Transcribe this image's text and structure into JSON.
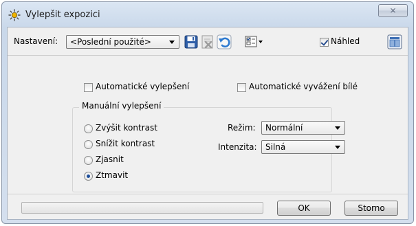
{
  "window": {
    "title": "Vylepšit expozici",
    "close_glyph": "⨯"
  },
  "toolbar": {
    "settings_label": "Nastavení:",
    "settings_value": "<Poslední použité>",
    "save_icon": "floppy-disk-icon",
    "delete_icon": "delete-preset-icon",
    "reset_icon": "undo-icon",
    "options_icon": "checklist-menu-icon",
    "preview_label": "Náhled",
    "preview_checked": true,
    "compare_icon": "split-view-icon"
  },
  "auto": {
    "auto_enhance_label": "Automatické vylepšení",
    "auto_enhance_checked": false,
    "auto_wb_label": "Automatické vyvážení bílé",
    "auto_wb_checked": false
  },
  "manual": {
    "title": "Manuální vylepšení",
    "options": [
      {
        "label": "Zvýšit kontrast",
        "selected": false
      },
      {
        "label": "Snížit kontrast",
        "selected": false
      },
      {
        "label": "Zjasnit",
        "selected": false
      },
      {
        "label": "Ztmavit",
        "selected": true
      }
    ],
    "mode_label": "Režim:",
    "mode_value": "Normální",
    "intensity_label": "Intenzita:",
    "intensity_value": "Silná"
  },
  "footer": {
    "progress": 0,
    "ok_label": "OK",
    "cancel_label": "Storno"
  },
  "colors": {
    "accent": "#1d4e9a",
    "save_blue": "#2f5fa8",
    "undo_blue": "#2f7bd0"
  }
}
